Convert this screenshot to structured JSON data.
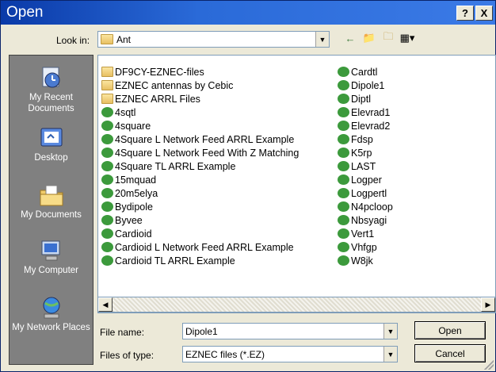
{
  "window": {
    "title": "Open",
    "help_label": "?",
    "close_label": "X"
  },
  "toolbar": {
    "look_in_label": "Look in:",
    "look_in_value": "Ant"
  },
  "places": [
    {
      "label": "My Recent Documents",
      "icon": "recent-documents-icon"
    },
    {
      "label": "Desktop",
      "icon": "desktop-icon"
    },
    {
      "label": "My Documents",
      "icon": "my-documents-icon"
    },
    {
      "label": "My Computer",
      "icon": "my-computer-icon"
    },
    {
      "label": "My Network Places",
      "icon": "network-places-icon"
    }
  ],
  "files_col1": [
    {
      "name": "DF9CY-EZNEC-files",
      "type": "folder"
    },
    {
      "name": "EZNEC antennas by Cebic",
      "type": "folder"
    },
    {
      "name": "EZNEC ARRL Files",
      "type": "folder"
    },
    {
      "name": "4sqtl",
      "type": "ez"
    },
    {
      "name": "4square",
      "type": "ez"
    },
    {
      "name": "4Square L Network Feed ARRL Example",
      "type": "ez"
    },
    {
      "name": "4Square L Network Feed With Z Matching",
      "type": "ez"
    },
    {
      "name": "4Square TL ARRL Example",
      "type": "ez"
    },
    {
      "name": "15mquad",
      "type": "ez"
    },
    {
      "name": "20m5elya",
      "type": "ez"
    },
    {
      "name": "Bydipole",
      "type": "ez"
    },
    {
      "name": "Byvee",
      "type": "ez"
    },
    {
      "name": "Cardioid",
      "type": "ez"
    },
    {
      "name": "Cardioid L Network Feed ARRL Example",
      "type": "ez"
    },
    {
      "name": "Cardioid TL ARRL Example",
      "type": "ez"
    }
  ],
  "files_col2": [
    {
      "name": "Cardtl",
      "type": "ez"
    },
    {
      "name": "Dipole1",
      "type": "ez"
    },
    {
      "name": "Diptl",
      "type": "ez"
    },
    {
      "name": "Elevrad1",
      "type": "ez"
    },
    {
      "name": "Elevrad2",
      "type": "ez"
    },
    {
      "name": "Fdsp",
      "type": "ez"
    },
    {
      "name": "K5rp",
      "type": "ez"
    },
    {
      "name": "LAST",
      "type": "ez"
    },
    {
      "name": "Logper",
      "type": "ez"
    },
    {
      "name": "Logpertl",
      "type": "ez"
    },
    {
      "name": "N4pcloop",
      "type": "ez"
    },
    {
      "name": "Nbsyagi",
      "type": "ez"
    },
    {
      "name": "Vert1",
      "type": "ez"
    },
    {
      "name": "Vhfgp",
      "type": "ez"
    },
    {
      "name": "W8jk",
      "type": "ez"
    }
  ],
  "form": {
    "file_name_label": "File name:",
    "file_name_value": "Dipole1",
    "file_type_label": "Files of type:",
    "file_type_value": "EZNEC files (*.EZ)",
    "open_label": "Open",
    "cancel_label": "Cancel"
  }
}
